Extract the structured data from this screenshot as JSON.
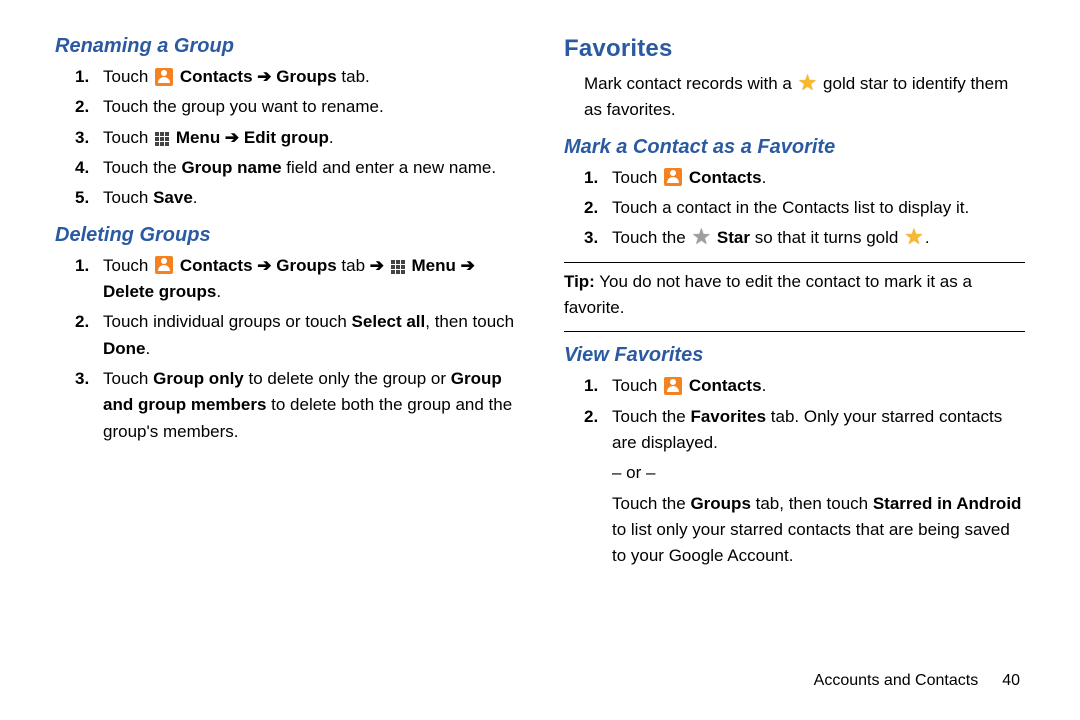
{
  "left": {
    "h_rename": "Renaming a Group",
    "rename_steps": {
      "s1a": "Touch ",
      "s1b": " Contacts ➔ Groups",
      "s1c": " tab.",
      "s2": "Touch the group you want to rename.",
      "s3a": "Touch ",
      "s3b": " Menu ➔ Edit group",
      "s3c": ".",
      "s4a": "Touch the ",
      "s4b": "Group name",
      "s4c": " field and enter a new name.",
      "s5a": "Touch ",
      "s5b": "Save",
      "s5c": "."
    },
    "h_delete": "Deleting Groups",
    "delete_steps": {
      "s1a": "Touch ",
      "s1b": " Contacts ➔ Groups",
      "s1c": " tab ",
      "s1d": "➔ ",
      "s1e": " Menu ➔ Delete groups",
      "s1f": ".",
      "s2a": "Touch individual groups or touch ",
      "s2b": "Select all",
      "s2c": ", then touch ",
      "s2d": "Done",
      "s2e": ".",
      "s3a": "Touch ",
      "s3b": "Group only",
      "s3c": " to delete only the group or ",
      "s3d": "Group and group members",
      "s3e": " to delete both the group and the group's members."
    }
  },
  "right": {
    "h_fav": "Favorites",
    "fav_intro_a": "Mark contact records with a ",
    "fav_intro_b": " gold star to identify them as favorites.",
    "h_mark": "Mark a Contact as a Favorite",
    "mark_steps": {
      "s1a": "Touch ",
      "s1b": " Contacts",
      "s1c": ".",
      "s2": "Touch a contact in the Contacts list  to display it.",
      "s3a": "Touch the ",
      "s3b": " Star",
      "s3c": " so that it turns gold ",
      "s3d": "."
    },
    "tip_a": "Tip:",
    "tip_b": " You do not have to edit the contact to mark it as a favorite.",
    "h_view": "View Favorites",
    "view_steps": {
      "s1a": "Touch ",
      "s1b": " Contacts",
      "s1c": ".",
      "s2a": "Touch the ",
      "s2b": "Favorites",
      "s2c": " tab. Only your starred contacts are displayed."
    },
    "or": "– or –",
    "view_alt_a": "Touch the ",
    "view_alt_b": "Groups",
    "view_alt_c": " tab, then touch ",
    "view_alt_d": "Starred in Android",
    "view_alt_e": " to list only your starred contacts that are being saved to your Google Account."
  },
  "footer": {
    "section": "Accounts and Contacts",
    "page": "40"
  }
}
